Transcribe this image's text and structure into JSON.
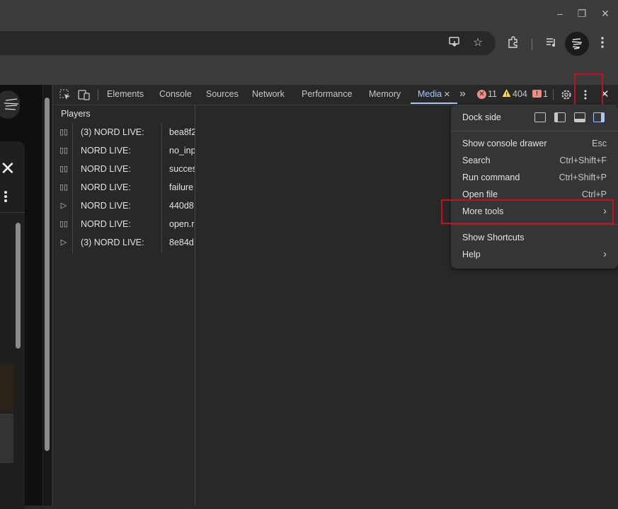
{
  "window": {
    "minimize": "–",
    "restore": "❐",
    "close": "✕"
  },
  "toolbar": {
    "icons": [
      "install-app-icon",
      "star-icon",
      "extensions-icon",
      "media-icon",
      "profile-avatar",
      "kebab-menu-icon"
    ]
  },
  "devtools": {
    "tabs": [
      "Elements",
      "Console",
      "Sources",
      "Network",
      "Performance",
      "Memory",
      "Media"
    ],
    "active_tab": "Media",
    "close_tab_glyph": "×",
    "more_tabs_glyph": "»",
    "errors": "11",
    "warnings": "404",
    "issues": "1",
    "players_header": "Players",
    "players": [
      {
        "state": "pause",
        "name": "(3) NORD LIVE:",
        "id": "bea8f2"
      },
      {
        "state": "pause",
        "name": "NORD LIVE:",
        "id": "no_inp"
      },
      {
        "state": "pause",
        "name": "NORD LIVE:",
        "id": "succes"
      },
      {
        "state": "pause",
        "name": "NORD LIVE:",
        "id": "failure"
      },
      {
        "state": "play",
        "name": "NORD LIVE:",
        "id": "440d8"
      },
      {
        "state": "pause",
        "name": "NORD LIVE:",
        "id": "open.r"
      },
      {
        "state": "play",
        "name": "(3) NORD LIVE:",
        "id": "8e84d"
      }
    ]
  },
  "menu": {
    "dock_side": "Dock side",
    "items": [
      {
        "label": "Show console drawer",
        "shortcut": "Esc"
      },
      {
        "label": "Search",
        "shortcut": "Ctrl+Shift+F"
      },
      {
        "label": "Run command",
        "shortcut": "Ctrl+Shift+P"
      },
      {
        "label": "Open file",
        "shortcut": "Ctrl+P"
      },
      {
        "label": "More tools",
        "shortcut": "›"
      }
    ],
    "items2": [
      {
        "label": "Show Shortcuts",
        "shortcut": ""
      },
      {
        "label": "Help",
        "shortcut": "›"
      }
    ]
  },
  "colors": {
    "highlight": "#c4111e",
    "accent": "#a8c7fa",
    "error": "#f28b82",
    "warning": "#fdd663"
  }
}
